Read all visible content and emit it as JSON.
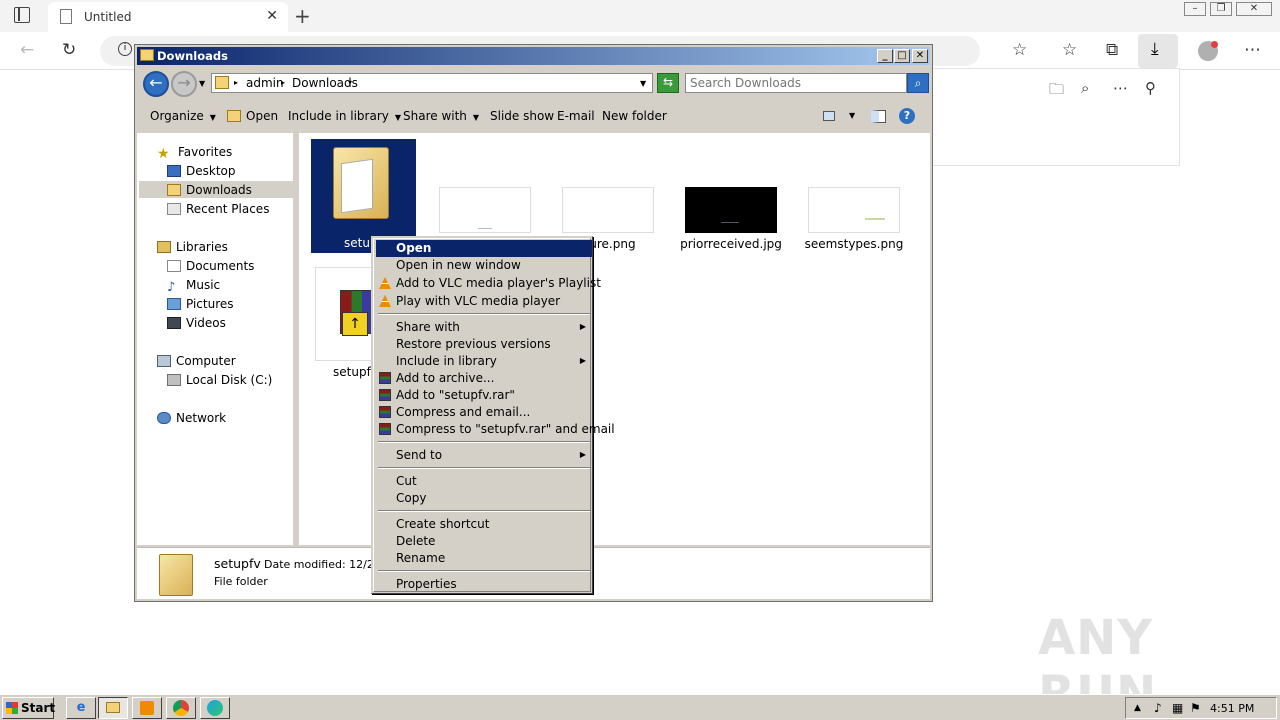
{
  "browser": {
    "tab_title": "Untitled",
    "new_tab": "+",
    "close_tab": "✕"
  },
  "explorer": {
    "title": "Downloads",
    "breadcrumb": [
      "admin",
      "Downloads"
    ],
    "search_placeholder": "Search Downloads",
    "commands": {
      "organize": "Organize",
      "open": "Open",
      "include_in_library": "Include in library",
      "share_with": "Share with",
      "slide_show": "Slide show",
      "email": "E-mail",
      "new_folder": "New folder"
    },
    "nav": {
      "favorites": "Favorites",
      "desktop": "Desktop",
      "downloads": "Downloads",
      "recent_places": "Recent Places",
      "libraries": "Libraries",
      "documents": "Documents",
      "music": "Music",
      "pictures": "Pictures",
      "videos": "Videos",
      "computer": "Computer",
      "local_disk": "Local Disk (C:)",
      "network": "Network"
    },
    "files": {
      "folder_partial": "setup",
      "culture": "culture.png",
      "priorreceived": "priorreceived.jpg",
      "seemstypes": "seemstypes.png",
      "setupfv_partial": "setupfv"
    },
    "details": {
      "name": "setupfv",
      "date_modified": "Date modified: 12/21/2",
      "type": "File folder"
    }
  },
  "context_menu": {
    "open": "Open",
    "open_new_window": "Open in new window",
    "add_vlc_playlist": "Add to VLC media player's Playlist",
    "play_vlc": "Play with VLC media player",
    "share_with": "Share with",
    "restore_previous": "Restore previous versions",
    "include_library": "Include in library",
    "add_archive": "Add to archive...",
    "add_rar": "Add to \"setupfv.rar\"",
    "compress_email": "Compress and email...",
    "compress_rar_email": "Compress to \"setupfv.rar\" and email",
    "send_to": "Send to",
    "cut": "Cut",
    "copy": "Copy",
    "create_shortcut": "Create shortcut",
    "delete": "Delete",
    "rename": "Rename",
    "properties": "Properties"
  },
  "taskbar": {
    "start": "Start",
    "clock": "4:51 PM"
  },
  "watermark": "ANY RUN"
}
